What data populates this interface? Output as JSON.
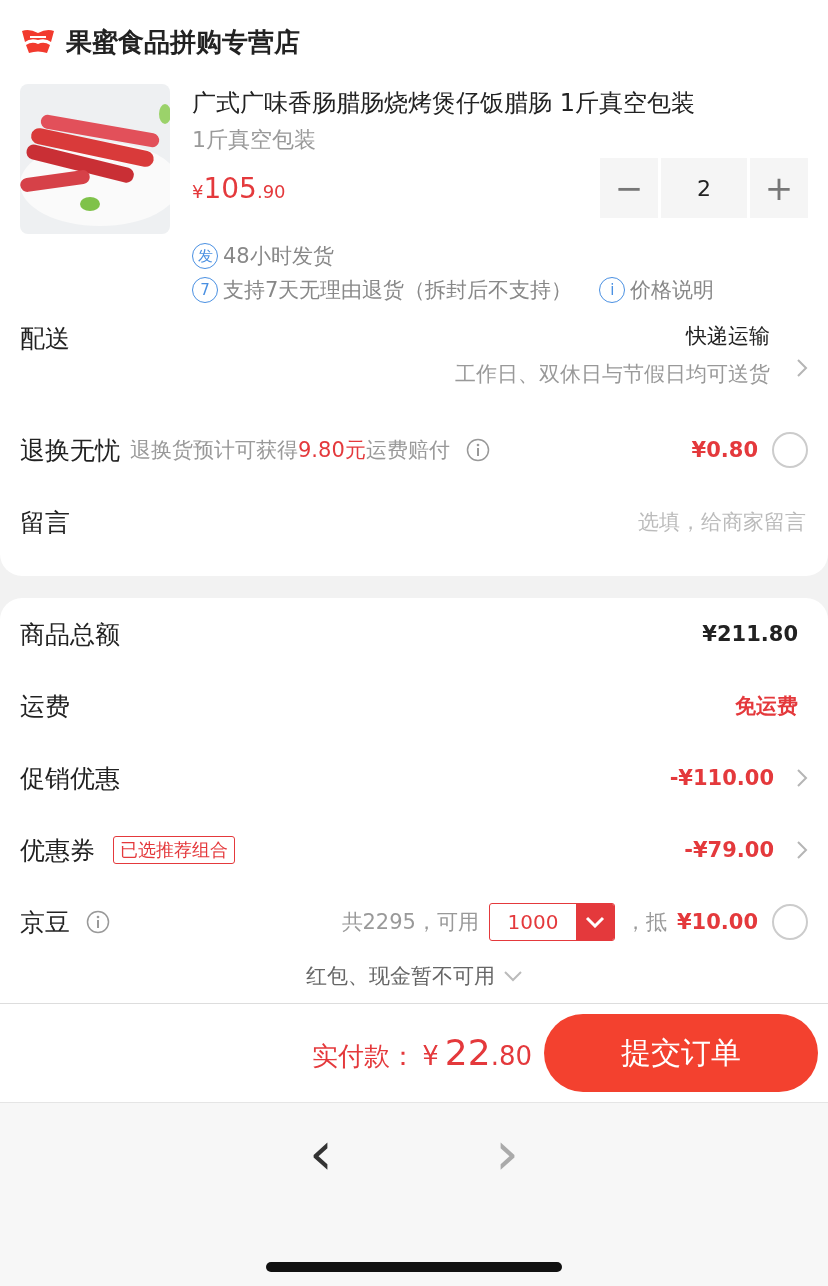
{
  "store": {
    "name": "果蜜食品拼购专营店"
  },
  "product": {
    "title": "广式广味香肠腊肠烧烤煲仔饭腊肠 1斤真空包装",
    "spec": "1斤真空包装",
    "price": {
      "symbol": "¥",
      "integer": "105",
      "decimal": ".90"
    },
    "quantity": {
      "minus": "−",
      "value": "2",
      "plus": "+"
    },
    "services": [
      {
        "badge": "发",
        "text": "48小时发货"
      },
      {
        "badge": "7",
        "text": "支持7天无理由退货（拆封后不支持）"
      }
    ],
    "price_note": {
      "badge": "i",
      "text": "价格说明"
    }
  },
  "delivery": {
    "label": "配送",
    "method": "快递运输",
    "note": "工作日、双休日与节假日均可送货"
  },
  "return_insurance": {
    "label": "退换无忧",
    "desc": "退换货预计可获得**9.80元**运费赔付",
    "price": "¥0.80",
    "selected": false
  },
  "message": {
    "label": "留言",
    "placeholder": "选填，给商家留言"
  },
  "summary": [
    {
      "kind": "amount",
      "label": "商品总额",
      "value": "¥211.80",
      "red": false,
      "arrow": false
    },
    {
      "kind": "amount",
      "label": "运费",
      "value": "免运费",
      "red": true,
      "arrow": false
    },
    {
      "kind": "amount",
      "label": "促销优惠",
      "value": "-¥110.00",
      "red": true,
      "arrow": true
    },
    {
      "kind": "coupon",
      "label": "优惠券",
      "tag": "已选推荐组合",
      "value": "-¥79.00",
      "red": true,
      "arrow": true
    }
  ],
  "beans": {
    "label": "京豆",
    "total": "共2295，可用",
    "amount": "1000",
    "offset": "，抵",
    "value": "¥10.00",
    "selected": false
  },
  "red_packet": {
    "text": "红包、现金暂不可用"
  },
  "footer": {
    "label": "实付款：",
    "symbol": "¥",
    "integer": "22",
    "decimal": ".80",
    "submit": "提交订单"
  },
  "nav": {
    "back": "‹",
    "forward": "›"
  }
}
